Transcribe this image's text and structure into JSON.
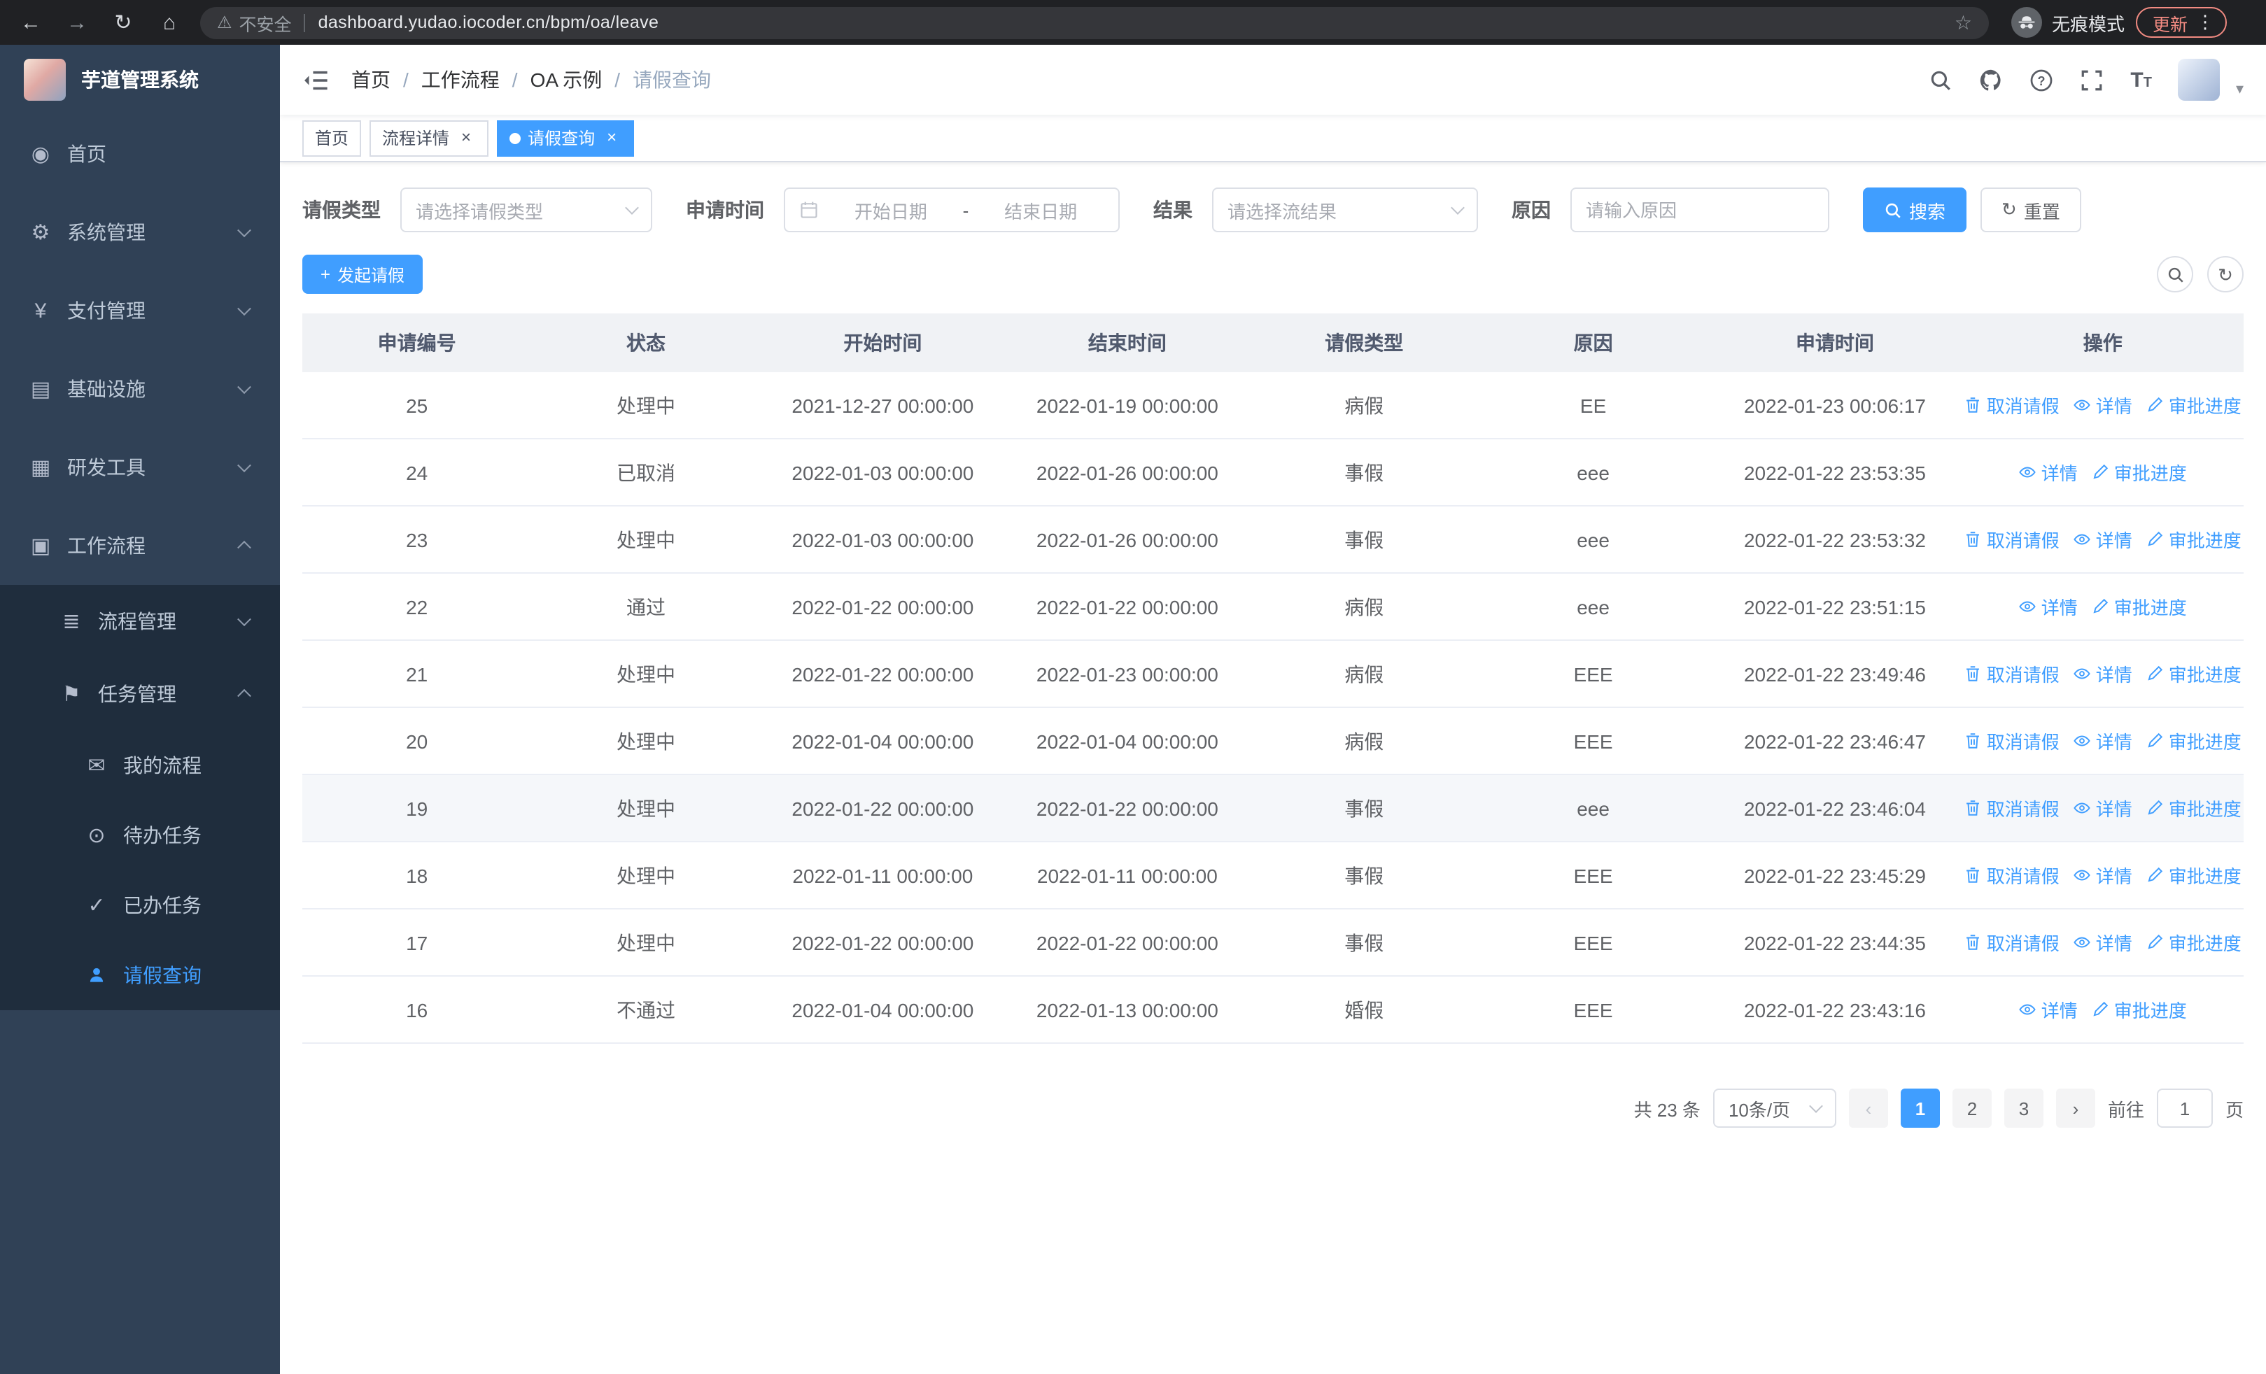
{
  "browser": {
    "security_warning": "不安全",
    "url": "dashboard.yudao.iocoder.cn/bpm/oa/leave",
    "incognito_label": "无痕模式",
    "update_label": "更新"
  },
  "sidebar": {
    "logo_title": "芋道管理系统",
    "menu": [
      {
        "label": "首页"
      },
      {
        "label": "系统管理"
      },
      {
        "label": "支付管理"
      },
      {
        "label": "基础设施"
      },
      {
        "label": "研发工具"
      },
      {
        "label": "工作流程"
      }
    ],
    "submenu": [
      {
        "label": "流程管理"
      },
      {
        "label": "任务管理"
      }
    ],
    "task_children": [
      {
        "label": "我的流程"
      },
      {
        "label": "待办任务"
      },
      {
        "label": "已办任务"
      },
      {
        "label": "请假查询"
      }
    ]
  },
  "header": {
    "breadcrumb": [
      "首页",
      "工作流程",
      "OA 示例",
      "请假查询"
    ]
  },
  "tabs": [
    {
      "label": "首页"
    },
    {
      "label": "流程详情"
    },
    {
      "label": "请假查询"
    }
  ],
  "filters": {
    "leave_type_label": "请假类型",
    "leave_type_placeholder": "请选择请假类型",
    "apply_time_label": "申请时间",
    "start_date_placeholder": "开始日期",
    "date_separator": "-",
    "end_date_placeholder": "结束日期",
    "result_label": "结果",
    "result_placeholder": "请选择流结果",
    "reason_label": "原因",
    "reason_placeholder": "请输入原因",
    "search_button": "搜索",
    "reset_button": "重置"
  },
  "toolbar": {
    "create_button": "发起请假"
  },
  "table": {
    "headers": [
      "申请编号",
      "状态",
      "开始时间",
      "结束时间",
      "请假类型",
      "原因",
      "申请时间",
      "操作"
    ],
    "actions": {
      "cancel": "取消请假",
      "detail": "详情",
      "progress": "审批进度"
    },
    "rows": [
      {
        "id": "25",
        "status": "处理中",
        "start": "2021-12-27 00:00:00",
        "end": "2022-01-19 00:00:00",
        "type": "病假",
        "reason": "EE",
        "applied": "2022-01-23 00:06:17",
        "can_cancel": true
      },
      {
        "id": "24",
        "status": "已取消",
        "start": "2022-01-03 00:00:00",
        "end": "2022-01-26 00:00:00",
        "type": "事假",
        "reason": "eee",
        "applied": "2022-01-22 23:53:35",
        "can_cancel": false
      },
      {
        "id": "23",
        "status": "处理中",
        "start": "2022-01-03 00:00:00",
        "end": "2022-01-26 00:00:00",
        "type": "事假",
        "reason": "eee",
        "applied": "2022-01-22 23:53:32",
        "can_cancel": true
      },
      {
        "id": "22",
        "status": "通过",
        "start": "2022-01-22 00:00:00",
        "end": "2022-01-22 00:00:00",
        "type": "病假",
        "reason": "eee",
        "applied": "2022-01-22 23:51:15",
        "can_cancel": false
      },
      {
        "id": "21",
        "status": "处理中",
        "start": "2022-01-22 00:00:00",
        "end": "2022-01-23 00:00:00",
        "type": "病假",
        "reason": "EEE",
        "applied": "2022-01-22 23:49:46",
        "can_cancel": true
      },
      {
        "id": "20",
        "status": "处理中",
        "start": "2022-01-04 00:00:00",
        "end": "2022-01-04 00:00:00",
        "type": "病假",
        "reason": "EEE",
        "applied": "2022-01-22 23:46:47",
        "can_cancel": true
      },
      {
        "id": "19",
        "status": "处理中",
        "start": "2022-01-22 00:00:00",
        "end": "2022-01-22 00:00:00",
        "type": "事假",
        "reason": "eee",
        "applied": "2022-01-22 23:46:04",
        "can_cancel": true,
        "highlight": true
      },
      {
        "id": "18",
        "status": "处理中",
        "start": "2022-01-11 00:00:00",
        "end": "2022-01-11 00:00:00",
        "type": "事假",
        "reason": "EEE",
        "applied": "2022-01-22 23:45:29",
        "can_cancel": true
      },
      {
        "id": "17",
        "status": "处理中",
        "start": "2022-01-22 00:00:00",
        "end": "2022-01-22 00:00:00",
        "type": "事假",
        "reason": "EEE",
        "applied": "2022-01-22 23:44:35",
        "can_cancel": true
      },
      {
        "id": "16",
        "status": "不通过",
        "start": "2022-01-04 00:00:00",
        "end": "2022-01-13 00:00:00",
        "type": "婚假",
        "reason": "EEE",
        "applied": "2022-01-22 23:43:16",
        "can_cancel": false
      }
    ]
  },
  "pagination": {
    "total": "共 23 条",
    "page_size": "10条/页",
    "pages": [
      "1",
      "2",
      "3"
    ],
    "goto_label": "前往",
    "goto_value": "1",
    "goto_suffix": "页"
  }
}
